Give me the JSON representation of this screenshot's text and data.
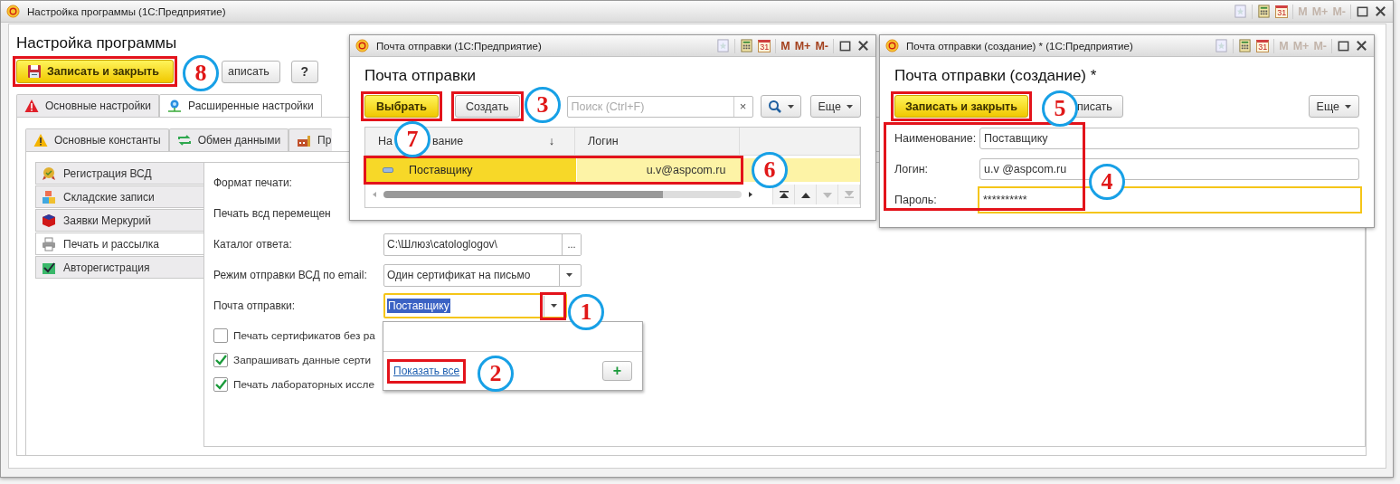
{
  "main_window": {
    "title": "Настройка программы  (1С:Предприятие)",
    "calendar_day": "31",
    "memory_keys": [
      "M",
      "M+",
      "M-"
    ],
    "memory_keys_disabled": true,
    "heading": "Настройка программы",
    "buttons": [
      {
        "kind": "primary",
        "label": "Записать и закрыть",
        "highlighted": true
      },
      {
        "kind": "covered",
        "label": "аписать",
        "highlighted": false
      },
      {
        "kind": "help",
        "label": "?",
        "highlighted": false
      }
    ],
    "tabs": [
      {
        "label": "Основные настройки",
        "selected": false
      },
      {
        "label": "Расширенные настройки",
        "selected": true
      }
    ],
    "subtabs": [
      {
        "label": "Основные константы",
        "selected": false
      },
      {
        "label": "Обмен данными",
        "selected": false
      },
      {
        "label": "Пр",
        "selected": false
      }
    ],
    "sections": [
      {
        "label": "Регистрация ВСД",
        "selected": false
      },
      {
        "label": "Складские записи",
        "selected": false
      },
      {
        "label": "Заявки Меркурий",
        "selected": false
      },
      {
        "label": "Печать и рассылка",
        "selected": true
      },
      {
        "label": "Авторегистрация",
        "selected": false
      }
    ],
    "form": [
      {
        "kind": "label",
        "label": "Формат печати:"
      },
      {
        "kind": "label",
        "label": "Печать всд перемещен"
      },
      {
        "kind": "path",
        "label": "Каталог ответа:",
        "value": "C:\\Шлюз\\catologlogov\\",
        "button": "..."
      },
      {
        "kind": "select",
        "label": "Режим отправки ВСД по email:",
        "value": "Один сертификат на письмо",
        "focused": false,
        "button_highlighted": false
      },
      {
        "kind": "select",
        "label": "Почта отправки:",
        "value": "Поставщику",
        "focused": true,
        "button_highlighted": true
      }
    ],
    "checkboxes": [
      {
        "label": "Печать сертификатов без ра",
        "checked": false
      },
      {
        "label": "Запрашивать данные серти",
        "checked": true
      },
      {
        "label": "Печать лабораторных иссле",
        "checked": true
      }
    ],
    "dropdown": {
      "link": "Показать все",
      "link_highlighted": true,
      "add_button": "+"
    }
  },
  "select_window": {
    "title": "Почта отправки  (1С:Предприятие)",
    "calendar_day": "31",
    "memory_keys": [
      "M",
      "M+",
      "M-"
    ],
    "memory_keys_disabled": false,
    "heading": "Почта отправки",
    "buttons": [
      {
        "kind": "primary",
        "label": "Выбрать",
        "highlighted": true
      },
      {
        "kind": "normal",
        "label": "Создать",
        "highlighted": true
      }
    ],
    "search": {
      "placeholder": "Поиск (Ctrl+F)",
      "clear": "×"
    },
    "more_button": "Еще",
    "columns": [
      {
        "label": "На",
        "label_rest": "вание",
        "sort_mark": "↓"
      },
      {
        "label": "Логин"
      }
    ],
    "rows": [
      {
        "name": "Поставщику",
        "login": "u.v@aspcom.ru",
        "selected": true,
        "highlighted": true
      }
    ]
  },
  "create_window": {
    "title": "Почта отправки (создание) *  (1С:Предприятие)",
    "calendar_day": "31",
    "memory_keys": [
      "M",
      "M+",
      "M-"
    ],
    "memory_keys_disabled": true,
    "heading": "Почта отправки (создание) *",
    "buttons": [
      {
        "kind": "primary",
        "label": "Записать и закрыть",
        "highlighted": true
      },
      {
        "kind": "covered",
        "label": "писать",
        "highlighted": false
      }
    ],
    "more_button": "Еще",
    "fields_highlighted": true,
    "fields": [
      {
        "label": "Наименование:",
        "value": "Поставщику",
        "focused": false
      },
      {
        "label": "Логин:",
        "value": "u.v @aspcom.ru",
        "focused": false
      },
      {
        "label": "Пароль:",
        "value": "**********",
        "focused": true
      }
    ]
  },
  "callouts": [
    {
      "number": "8"
    },
    {
      "number": "3"
    },
    {
      "number": "7"
    },
    {
      "number": "6"
    },
    {
      "number": "5"
    },
    {
      "number": "4"
    },
    {
      "number": "1"
    },
    {
      "number": "2"
    }
  ]
}
